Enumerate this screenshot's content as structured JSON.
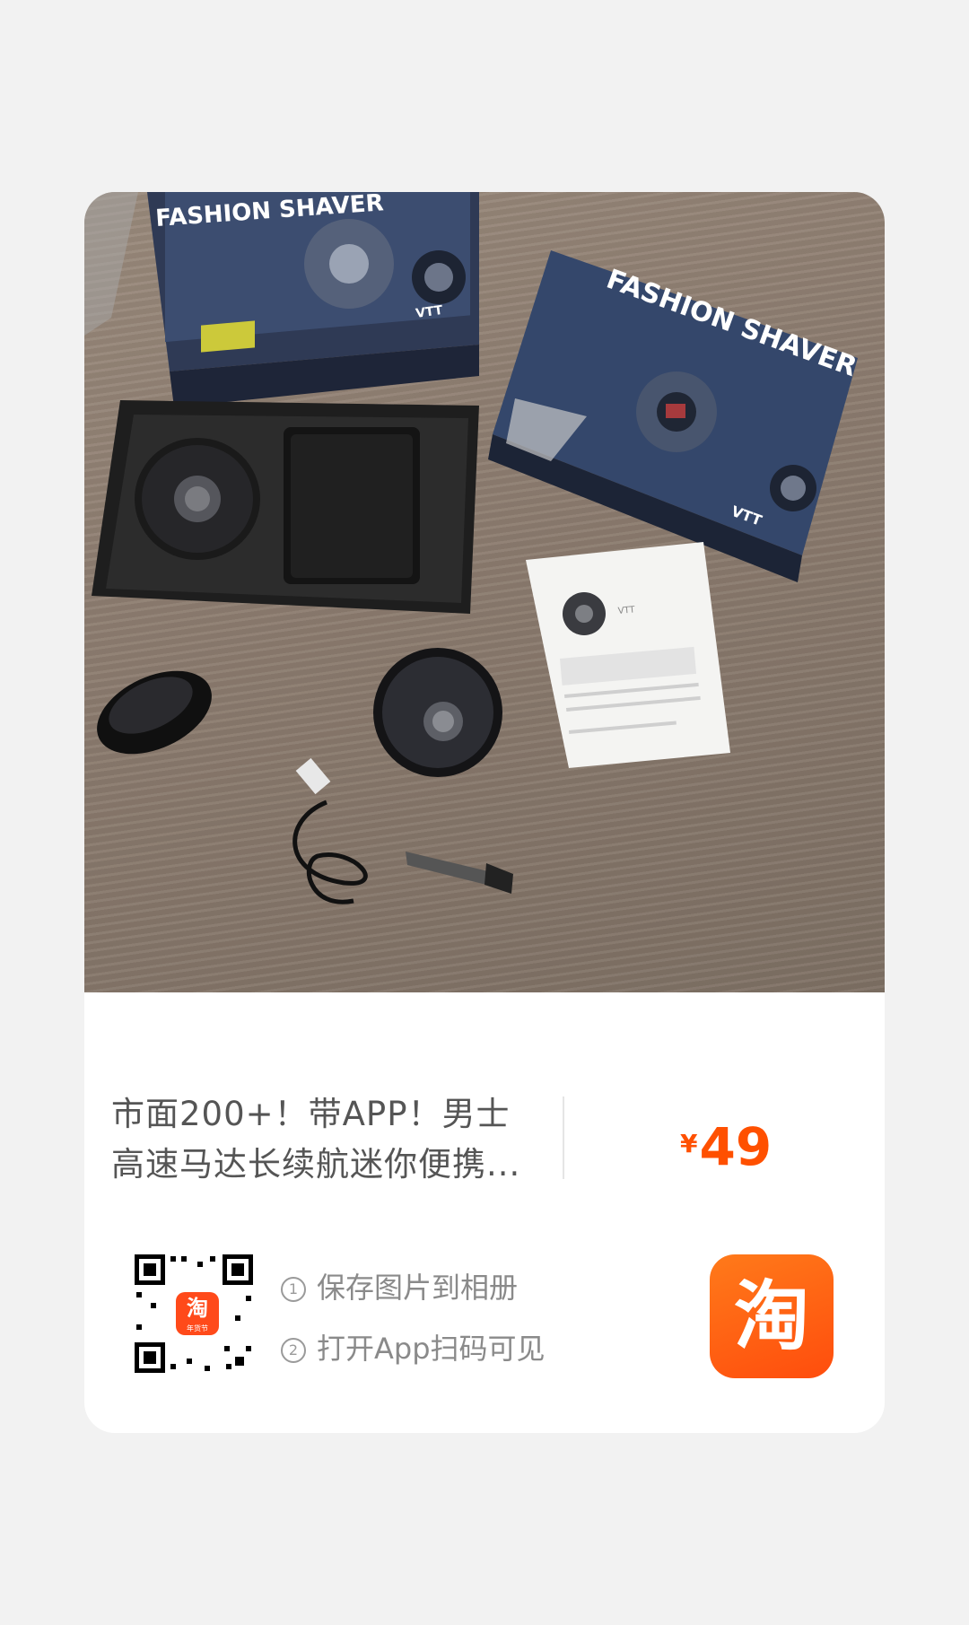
{
  "product": {
    "image_alt": "FASHION SHAVER",
    "box_title": "FASHION SHAVER",
    "box_brand": "VTT",
    "manual_brand": "VTT",
    "title_line1": "市面200+！带APP！男士",
    "title_line2": "高速马达长续航迷你便携...",
    "price_symbol": "¥",
    "price_value": "49"
  },
  "share": {
    "step1_num": "①",
    "step1_text": "保存图片到相册",
    "step2_num": "②",
    "step2_text": "打开App扫码可见",
    "qr_badge_char": "淘",
    "qr_badge_sub": "年货节",
    "app_icon_char": "淘"
  },
  "colors": {
    "price": "#ff5000",
    "app_icon": "#ff5a0f",
    "background": "#f2f2f2",
    "card": "#ffffff"
  }
}
